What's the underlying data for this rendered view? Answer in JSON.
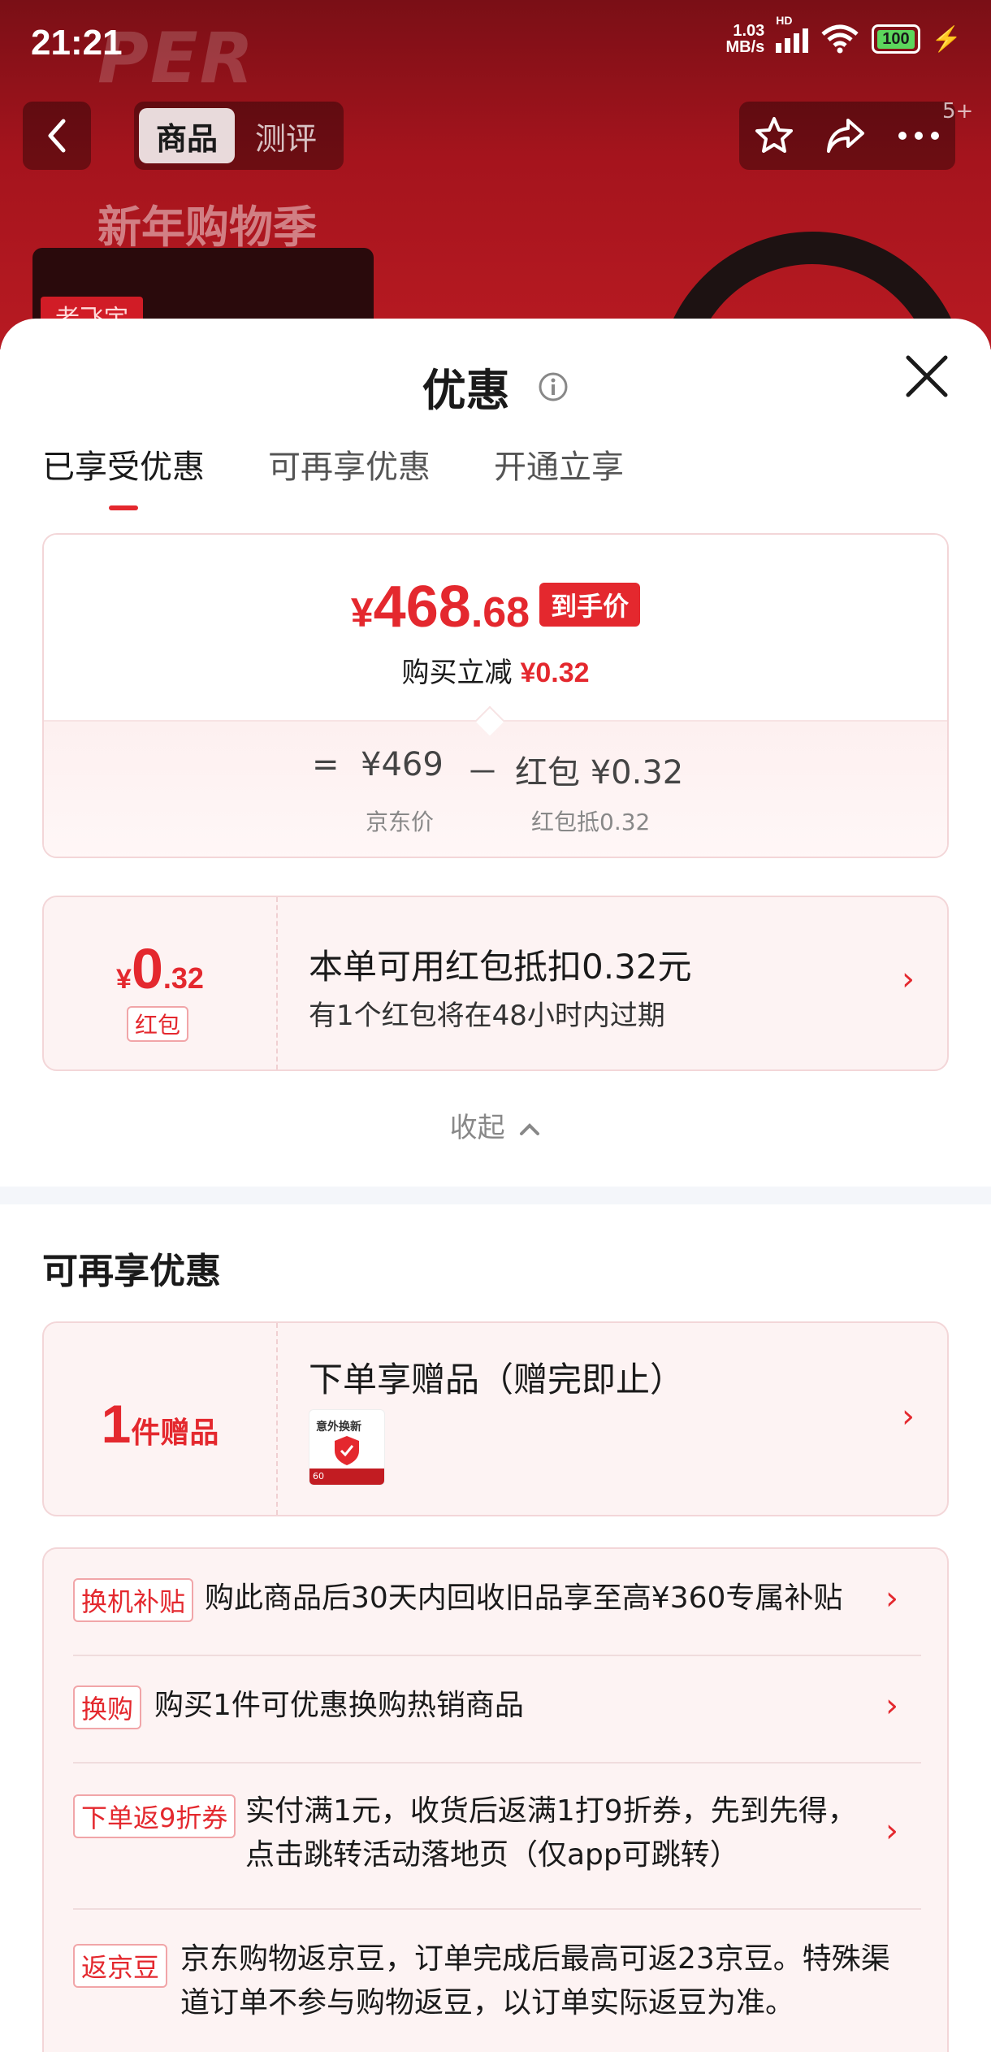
{
  "status_bar": {
    "time": "21:21",
    "net_speed_value": "1.03",
    "net_speed_unit": "MB/s",
    "hd_label": "HD",
    "battery": "100",
    "colors": {
      "battery_fill": "#5cd65c"
    }
  },
  "background": {
    "watermark": "PER",
    "banner": "新年购物季",
    "tag": "老飞宇",
    "badge": "5+"
  },
  "top_nav": {
    "tabs": [
      {
        "label": "商品",
        "active": true
      },
      {
        "label": "测评",
        "active": false
      }
    ],
    "icons": [
      "back-icon",
      "star-icon",
      "share-icon",
      "more-icon"
    ]
  },
  "sheet": {
    "title": "优惠",
    "tabs": [
      {
        "label": "已享受优惠",
        "active": true
      },
      {
        "label": "可再享优惠",
        "active": false
      },
      {
        "label": "开通立享",
        "active": false
      }
    ],
    "price": {
      "symbol": "¥",
      "integer": "468",
      "decimal": ".68",
      "tag": "到手价",
      "reduce_label": "购买立减",
      "reduce_amount": "¥0.32",
      "formula": {
        "equals": "=",
        "base": "¥469",
        "minus": "－",
        "deduct": "红包 ¥0.32",
        "base_label": "京东价",
        "deduct_label": "红包抵0.32"
      }
    },
    "red_packet": {
      "symbol": "¥",
      "integer": "0",
      "decimal": ".32",
      "label": "红包",
      "title": "本单可用红包抵扣0.32元",
      "subtitle": "有1个红包将在48小时内过期"
    },
    "collapse_label": "收起",
    "more_section": {
      "title": "可再享优惠",
      "gift": {
        "count": "1",
        "unit": "件赠品",
        "title": "下单享赠品（赠完即止）",
        "thumb_title": "意外换新",
        "thumb_badge": "60"
      },
      "promos": [
        {
          "tag": "换机补贴",
          "text": "购此商品后30天内回收旧品享至高¥360专属补贴"
        },
        {
          "tag": "换购",
          "text": "购买1件可优惠换购热销商品"
        },
        {
          "tag": "下单返9折券",
          "line1": "实付满1元，收货后返满1打9折券，先到先得，",
          "line2": "点击跳转活动落地页（仅app可跳转）"
        },
        {
          "tag": "返京豆",
          "line1": "京东购物返京豆，订单完成后最高可返23京豆。特殊渠",
          "line2": "道订单不参与购物返豆，以订单实际返豆为准。"
        }
      ]
    },
    "colors": {
      "accent": "#e4282e",
      "card_bg": "#fdf3f3",
      "card_border": "#f3d6d8"
    }
  }
}
